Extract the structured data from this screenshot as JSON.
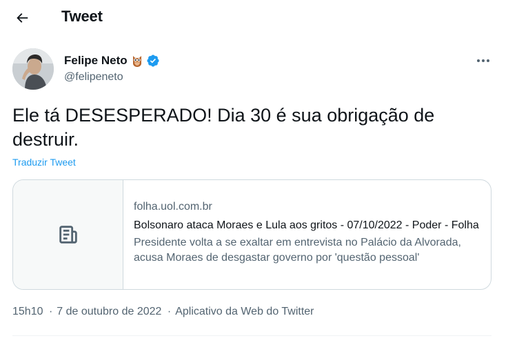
{
  "header": {
    "title": "Tweet",
    "back_icon": "arrow-left-icon"
  },
  "author": {
    "display_name": "Felipe Neto",
    "emoji": "🦉",
    "verified": true,
    "handle": "@felipeneto"
  },
  "tweet": {
    "text": "Ele tá DESESPERADO! Dia 30 é sua obrigação de destruir.",
    "translate_label": "Traduzir Tweet"
  },
  "card": {
    "thumbnail_icon": "document-icon",
    "domain": "folha.uol.com.br",
    "title": "Bolsonaro ataca Moraes e Lula aos gritos - 07/10/2022 - Poder - Folha",
    "description": "Presidente volta a se exaltar em entrevista no Palácio da Alvorada, acusa Moraes de desgastar governo por 'questão pessoal'"
  },
  "meta": {
    "time": "15h10",
    "separator": "·",
    "date": "7 de outubro de 2022",
    "source": "Aplicativo da Web do Twitter"
  },
  "colors": {
    "accent": "#1d9bf0",
    "text_primary": "#0f1419",
    "text_secondary": "#536471",
    "border": "#cfd9de"
  }
}
